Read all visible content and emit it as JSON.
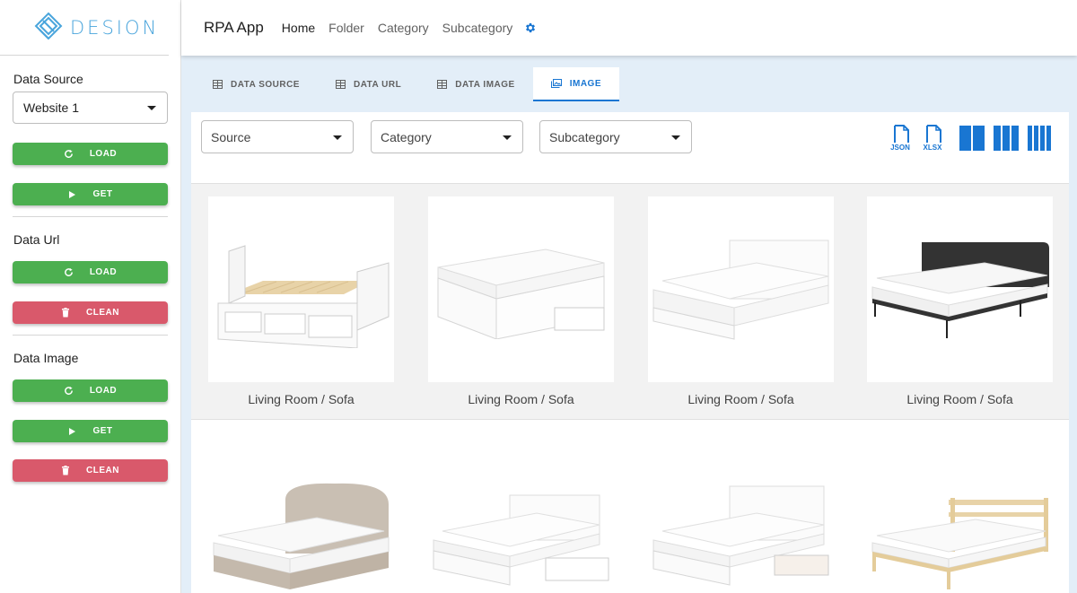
{
  "brand": {
    "logo_text": "DESION",
    "accent": "#4aa5dc"
  },
  "sidebar": {
    "data_source": {
      "title": "Data Source",
      "select_value": "Website 1",
      "load_label": "LOAD",
      "get_label": "GET"
    },
    "data_url": {
      "title": "Data Url",
      "load_label": "LOAD",
      "clean_label": "CLEAN"
    },
    "data_image": {
      "title": "Data Image",
      "load_label": "LOAD",
      "get_label": "GET",
      "clean_label": "CLEAN"
    }
  },
  "topbar": {
    "app_title": "RPA App",
    "nav": [
      "Home",
      "Folder",
      "Category",
      "Subcategory"
    ],
    "active_nav": "Home"
  },
  "tabs": [
    {
      "label": "DATA SOURCE",
      "icon": "table-icon"
    },
    {
      "label": "DATA URL",
      "icon": "table-icon"
    },
    {
      "label": "DATA IMAGE",
      "icon": "table-icon"
    },
    {
      "label": "IMAGE",
      "icon": "image-icon",
      "active": true
    }
  ],
  "filters": {
    "source": "Source",
    "category": "Category",
    "subcategory": "Subcategory"
  },
  "tools": {
    "json_label": "JSON",
    "xlsx_label": "XLSX"
  },
  "images": [
    {
      "caption": "Living Room / Sofa",
      "kind": "daybed"
    },
    {
      "caption": "Living Room / Sofa",
      "kind": "storage-bed"
    },
    {
      "caption": "Living Room / Sofa",
      "kind": "white-bed"
    },
    {
      "caption": "Living Room / Sofa",
      "kind": "dark-upholstered-bed"
    },
    {
      "caption": "",
      "kind": "upholstered-bed"
    },
    {
      "caption": "",
      "kind": "storage-bed-drawers"
    },
    {
      "caption": "",
      "kind": "white-bed-drawers"
    },
    {
      "caption": "",
      "kind": "pine-bed"
    }
  ],
  "colors": {
    "green": "#4caf50",
    "red": "#d9596b",
    "blue": "#1976d2",
    "content_bg": "#e3eef8"
  }
}
